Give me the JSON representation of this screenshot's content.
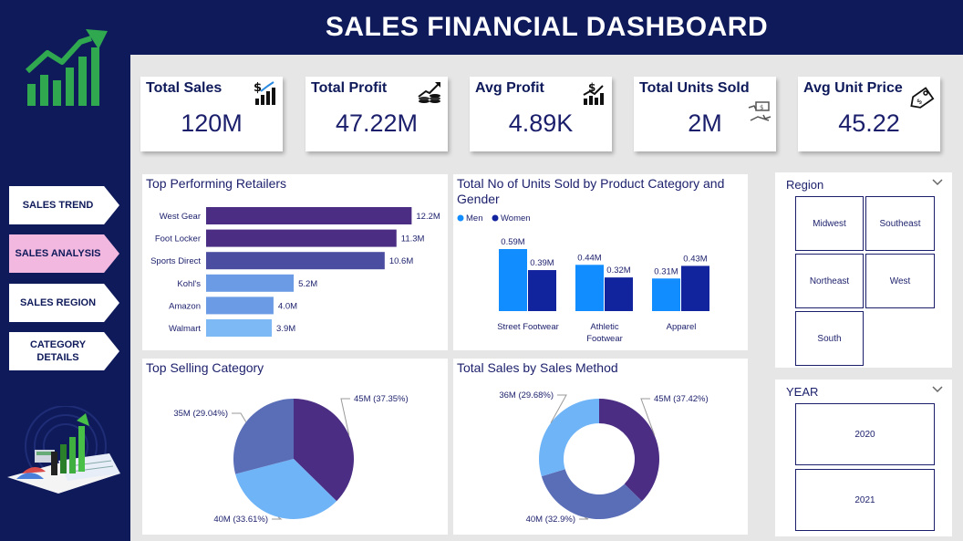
{
  "header": {
    "title": "SALES FINANCIAL DASHBOARD"
  },
  "nav": {
    "items": [
      {
        "label": "SALES TREND"
      },
      {
        "label": "SALES ANALYSIS"
      },
      {
        "label": "SALES REGION"
      },
      {
        "label": "CATEGORY\nDETAILS"
      }
    ],
    "active": "SALES ANALYSIS"
  },
  "kpis": [
    {
      "title": "Total Sales",
      "value": "120M",
      "icon": "money-chart-icon"
    },
    {
      "title": "Total Profit",
      "value": "47.22M",
      "icon": "coins-chart-icon"
    },
    {
      "title": "Avg Profit",
      "value": "4.89K",
      "icon": "growth-dollar-icon"
    },
    {
      "title": "Total Units Sold",
      "value": "2M",
      "icon": "hand-cash-icon"
    },
    {
      "title": "Avg Unit Price",
      "value": "45.22",
      "icon": "price-tag-icon"
    }
  ],
  "retailers": {
    "title": "Top Performing Retailers",
    "chart_data": {
      "type": "bar",
      "categories": [
        "West Gear",
        "Foot Locker",
        "Sports Direct",
        "Kohl's",
        "Amazon",
        "Walmart"
      ],
      "values": [
        12.2,
        11.3,
        10.6,
        5.2,
        4.0,
        3.9
      ],
      "labels": [
        "12.2M",
        "11.3M",
        "10.6M",
        "5.2M",
        "4.0M",
        "3.9M"
      ],
      "colors": [
        "#4b2e83",
        "#4b2e83",
        "#4b4ea0",
        "#6a9be4",
        "#6a9be4",
        "#7db9f5"
      ]
    }
  },
  "units": {
    "title": "Total No of Units Sold by Product Category and Gender",
    "chart_data": {
      "type": "bar",
      "categories": [
        "Street Footwear",
        "Athletic\nFootwear",
        "Apparel"
      ],
      "series": [
        {
          "name": "Men",
          "values": [
            0.59,
            0.44,
            0.31
          ],
          "labels": [
            "0.59M",
            "0.44M",
            "0.31M"
          ],
          "color": "#118dff"
        },
        {
          "name": "Women",
          "values": [
            0.39,
            0.32,
            0.43
          ],
          "labels": [
            "0.39M",
            "0.32M",
            "0.43M"
          ],
          "color": "#12239e"
        }
      ]
    }
  },
  "category": {
    "title": "Top Selling Category",
    "chart_data": {
      "type": "pie",
      "slices": [
        {
          "label": "45M (37.35%)",
          "value": 37.35,
          "color": "#4b2e83"
        },
        {
          "label": "40M (33.61%)",
          "value": 33.61,
          "color": "#6fb4f7"
        },
        {
          "label": "35M (29.04%)",
          "value": 29.04,
          "color": "#5a6eb8"
        }
      ]
    }
  },
  "method": {
    "title": "Total Sales by Sales Method",
    "chart_data": {
      "type": "pie",
      "slices": [
        {
          "label": "45M (37.42%)",
          "value": 37.42,
          "color": "#4b2e83"
        },
        {
          "label": "40M (32.9%)",
          "value": 32.9,
          "color": "#5a6eb8"
        },
        {
          "label": "36M (29.68%)",
          "value": 29.68,
          "color": "#6fb4f7"
        }
      ]
    }
  },
  "region": {
    "title": "Region",
    "options": [
      "Midwest",
      "Southeast",
      "Northeast",
      "West",
      "South"
    ]
  },
  "year": {
    "title": "YEAR",
    "options": [
      "2020",
      "2021"
    ]
  }
}
